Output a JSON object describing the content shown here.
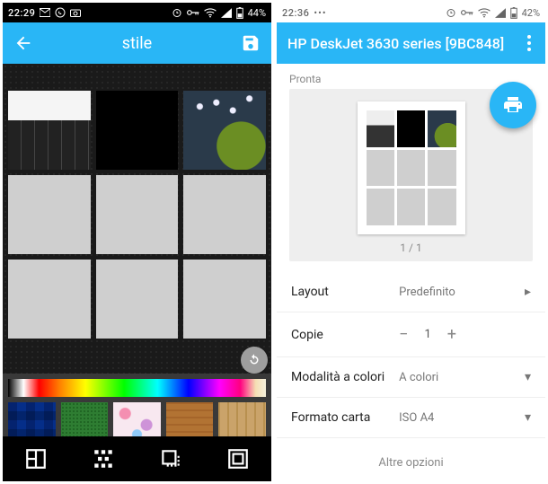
{
  "left": {
    "status": {
      "time": "22:29",
      "battery_text": "44%"
    },
    "appbar": {
      "title": "stile"
    },
    "tools": {
      "layout": "layout-grid",
      "pattern": "pattern-checker",
      "stack": "stack-shadow",
      "frame": "frame-full"
    }
  },
  "right": {
    "status": {
      "time": "22:36",
      "battery_text": "42%"
    },
    "appbar": {
      "title": "HP DeskJet 3630 series [9BC848]"
    },
    "status_line": "Pronta",
    "paging": "1 / 1",
    "options": {
      "layout_label": "Layout",
      "layout_value": "Predefinito",
      "copies_label": "Copie",
      "copies_value": "1",
      "color_label": "Modalità a colori",
      "color_value": "A colori",
      "paper_label": "Formato carta",
      "paper_value": "ISO A4",
      "more": "Altre opzioni"
    }
  }
}
